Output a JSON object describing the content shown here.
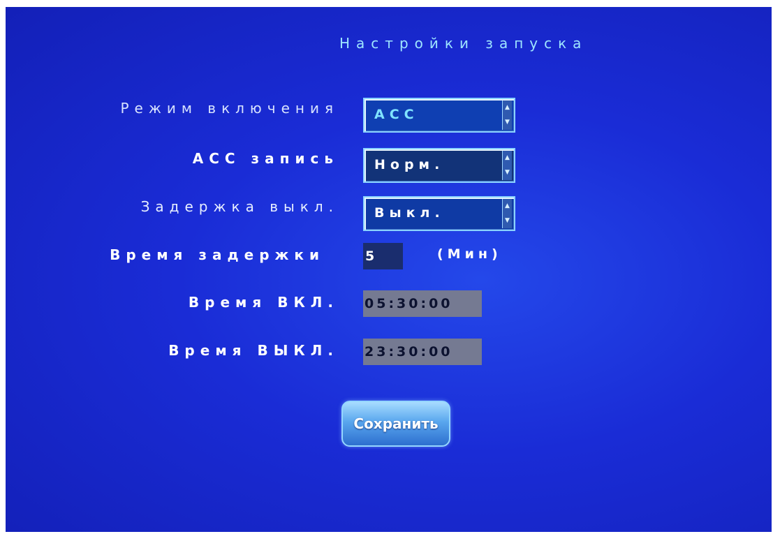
{
  "title": "Настройки запуска",
  "fields": [
    {
      "label": "Режим включения",
      "value": "ACC"
    },
    {
      "label": "ACC запись",
      "value": "Норм."
    },
    {
      "label": "Задержка выкл.",
      "value": "Выкл."
    },
    {
      "label": "Время задержки",
      "value": "5",
      "unit": "(Мин)"
    },
    {
      "label": "Время ВКЛ.",
      "value": "05:30:00"
    },
    {
      "label": "Время ВЫКЛ.",
      "value": "23:30:00"
    }
  ],
  "save_label": "Сохранить",
  "colors": {
    "background": "#1a2cd6",
    "title": "#9fe6ff",
    "accent_value": "#7fe3ff",
    "time_field": "#757a92"
  }
}
